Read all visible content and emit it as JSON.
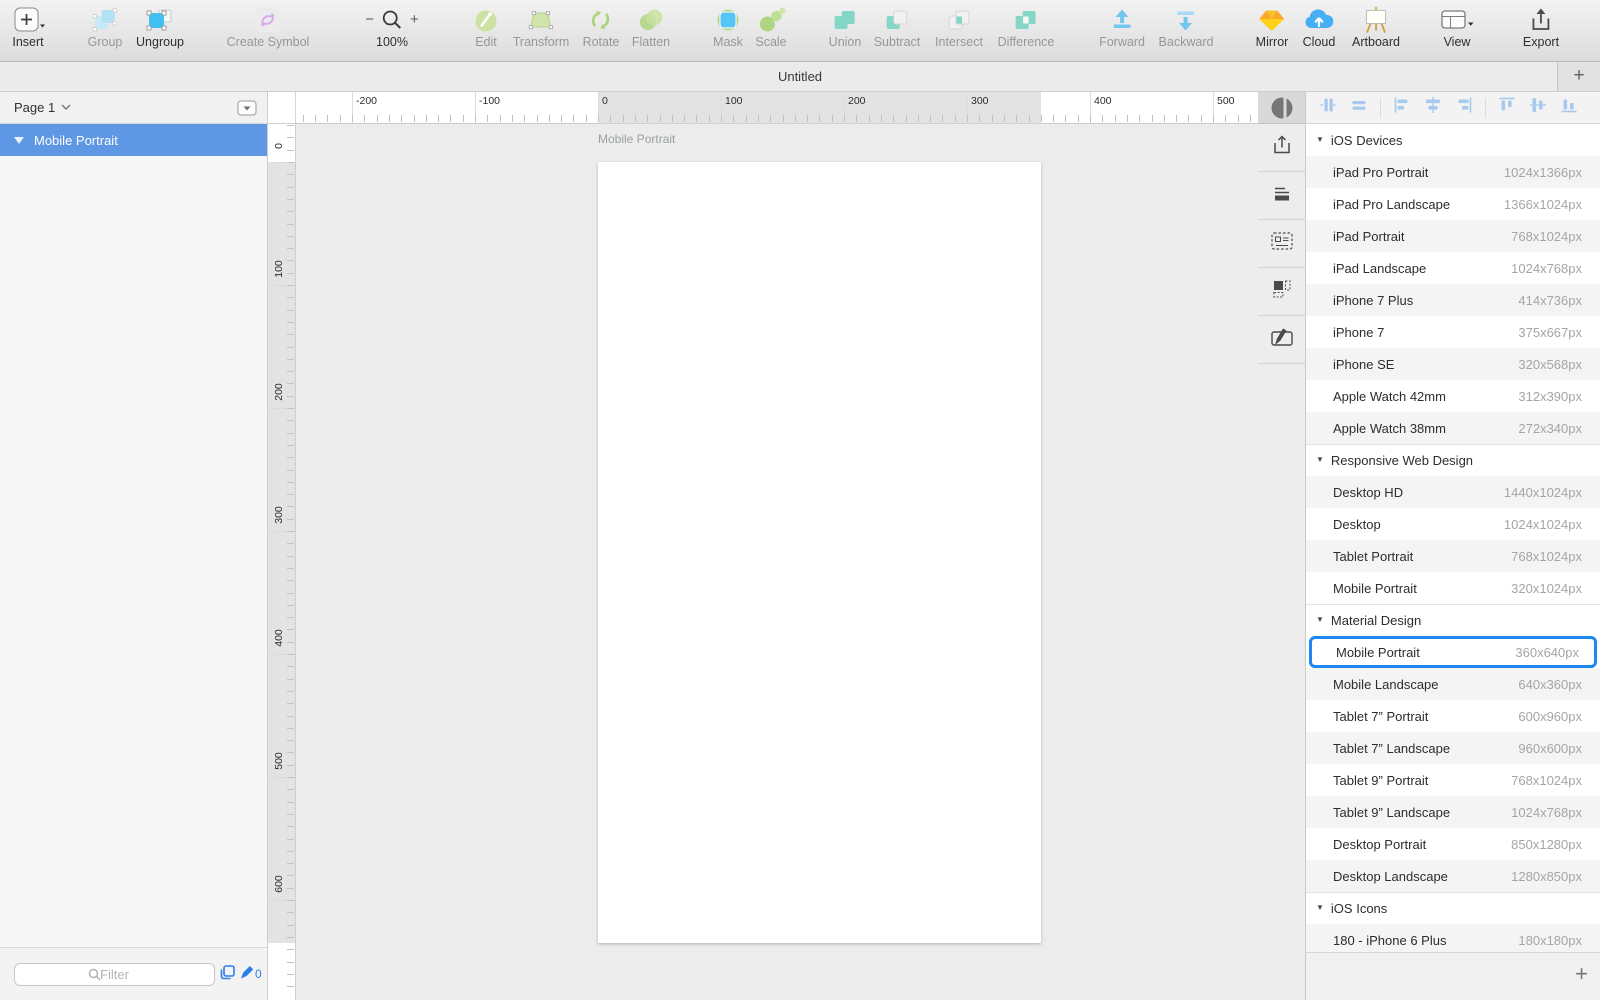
{
  "toolbar": {
    "items": [
      {
        "id": "insert",
        "label": "Insert",
        "enabled": true
      },
      {
        "id": "group",
        "label": "Group",
        "enabled": false
      },
      {
        "id": "ungroup",
        "label": "Ungroup",
        "enabled": true
      },
      {
        "id": "create-symbol",
        "label": "Create Symbol",
        "enabled": false
      },
      {
        "id": "zoom",
        "label": "100%",
        "enabled": true
      },
      {
        "id": "edit",
        "label": "Edit",
        "enabled": false
      },
      {
        "id": "transform",
        "label": "Transform",
        "enabled": false
      },
      {
        "id": "rotate",
        "label": "Rotate",
        "enabled": false
      },
      {
        "id": "flatten",
        "label": "Flatten",
        "enabled": false
      },
      {
        "id": "mask",
        "label": "Mask",
        "enabled": false
      },
      {
        "id": "scale",
        "label": "Scale",
        "enabled": false
      },
      {
        "id": "union",
        "label": "Union",
        "enabled": false
      },
      {
        "id": "subtract",
        "label": "Subtract",
        "enabled": false
      },
      {
        "id": "intersect",
        "label": "Intersect",
        "enabled": false
      },
      {
        "id": "difference",
        "label": "Difference",
        "enabled": false
      },
      {
        "id": "forward",
        "label": "Forward",
        "enabled": false
      },
      {
        "id": "backward",
        "label": "Backward",
        "enabled": false
      },
      {
        "id": "mirror",
        "label": "Mirror",
        "enabled": true
      },
      {
        "id": "cloud",
        "label": "Cloud",
        "enabled": true
      },
      {
        "id": "artboard",
        "label": "Artboard",
        "enabled": true
      },
      {
        "id": "view",
        "label": "View",
        "enabled": true
      },
      {
        "id": "export",
        "label": "Export",
        "enabled": true
      }
    ]
  },
  "titlebar": {
    "title": "Untitled",
    "new_tab_label": "+"
  },
  "left_panel": {
    "page_selector_label": "Page 1",
    "selected_layer": "Mobile Portrait",
    "filter_placeholder": "Filter",
    "draft_count": "0"
  },
  "canvas": {
    "artboard_label": "Mobile Portrait",
    "h_ruler_labels": [
      "-200",
      "-100",
      "0",
      "100",
      "200",
      "300",
      "400",
      "500"
    ],
    "v_ruler_labels": [
      "0",
      "100",
      "200",
      "300",
      "400",
      "500",
      "600"
    ]
  },
  "right_panel": {
    "add_button_label": "+",
    "sections": [
      {
        "title": "iOS Devices",
        "items": [
          {
            "name": "iPad Pro Portrait",
            "size": "1024x1366px"
          },
          {
            "name": "iPad Pro Landscape",
            "size": "1366x1024px"
          },
          {
            "name": "iPad Portrait",
            "size": "768x1024px"
          },
          {
            "name": "iPad Landscape",
            "size": "1024x768px"
          },
          {
            "name": "iPhone 7 Plus",
            "size": "414x736px"
          },
          {
            "name": "iPhone 7",
            "size": "375x667px"
          },
          {
            "name": "iPhone SE",
            "size": "320x568px"
          },
          {
            "name": "Apple Watch 42mm",
            "size": "312x390px"
          },
          {
            "name": "Apple Watch 38mm",
            "size": "272x340px"
          }
        ]
      },
      {
        "title": "Responsive Web Design",
        "items": [
          {
            "name": "Desktop HD",
            "size": "1440x1024px"
          },
          {
            "name": "Desktop",
            "size": "1024x1024px"
          },
          {
            "name": "Tablet Portrait",
            "size": "768x1024px"
          },
          {
            "name": "Mobile Portrait",
            "size": "320x1024px"
          }
        ]
      },
      {
        "title": "Material Design",
        "items": [
          {
            "name": "Mobile Portrait",
            "size": "360x640px",
            "selected": true
          },
          {
            "name": "Mobile Landscape",
            "size": "640x360px"
          },
          {
            "name": "Tablet 7” Portrait",
            "size": "600x960px"
          },
          {
            "name": "Tablet 7” Landscape",
            "size": "960x600px"
          },
          {
            "name": "Tablet 9” Portrait",
            "size": "768x1024px"
          },
          {
            "name": "Tablet 9” Landscape",
            "size": "1024x768px"
          },
          {
            "name": "Desktop Portrait",
            "size": "850x1280px"
          },
          {
            "name": "Desktop Landscape",
            "size": "1280x850px"
          }
        ]
      },
      {
        "title": "iOS Icons",
        "items": [
          {
            "name": "180 - iPhone 6 Plus",
            "size": "180x180px"
          }
        ]
      }
    ]
  },
  "colors": {
    "layer_selection_blue": "#5e97e4",
    "selected_preset_border": "#1e87f0",
    "accent_blue": "#2d7ee8",
    "align_icon_blue": "#a6c9ed"
  }
}
